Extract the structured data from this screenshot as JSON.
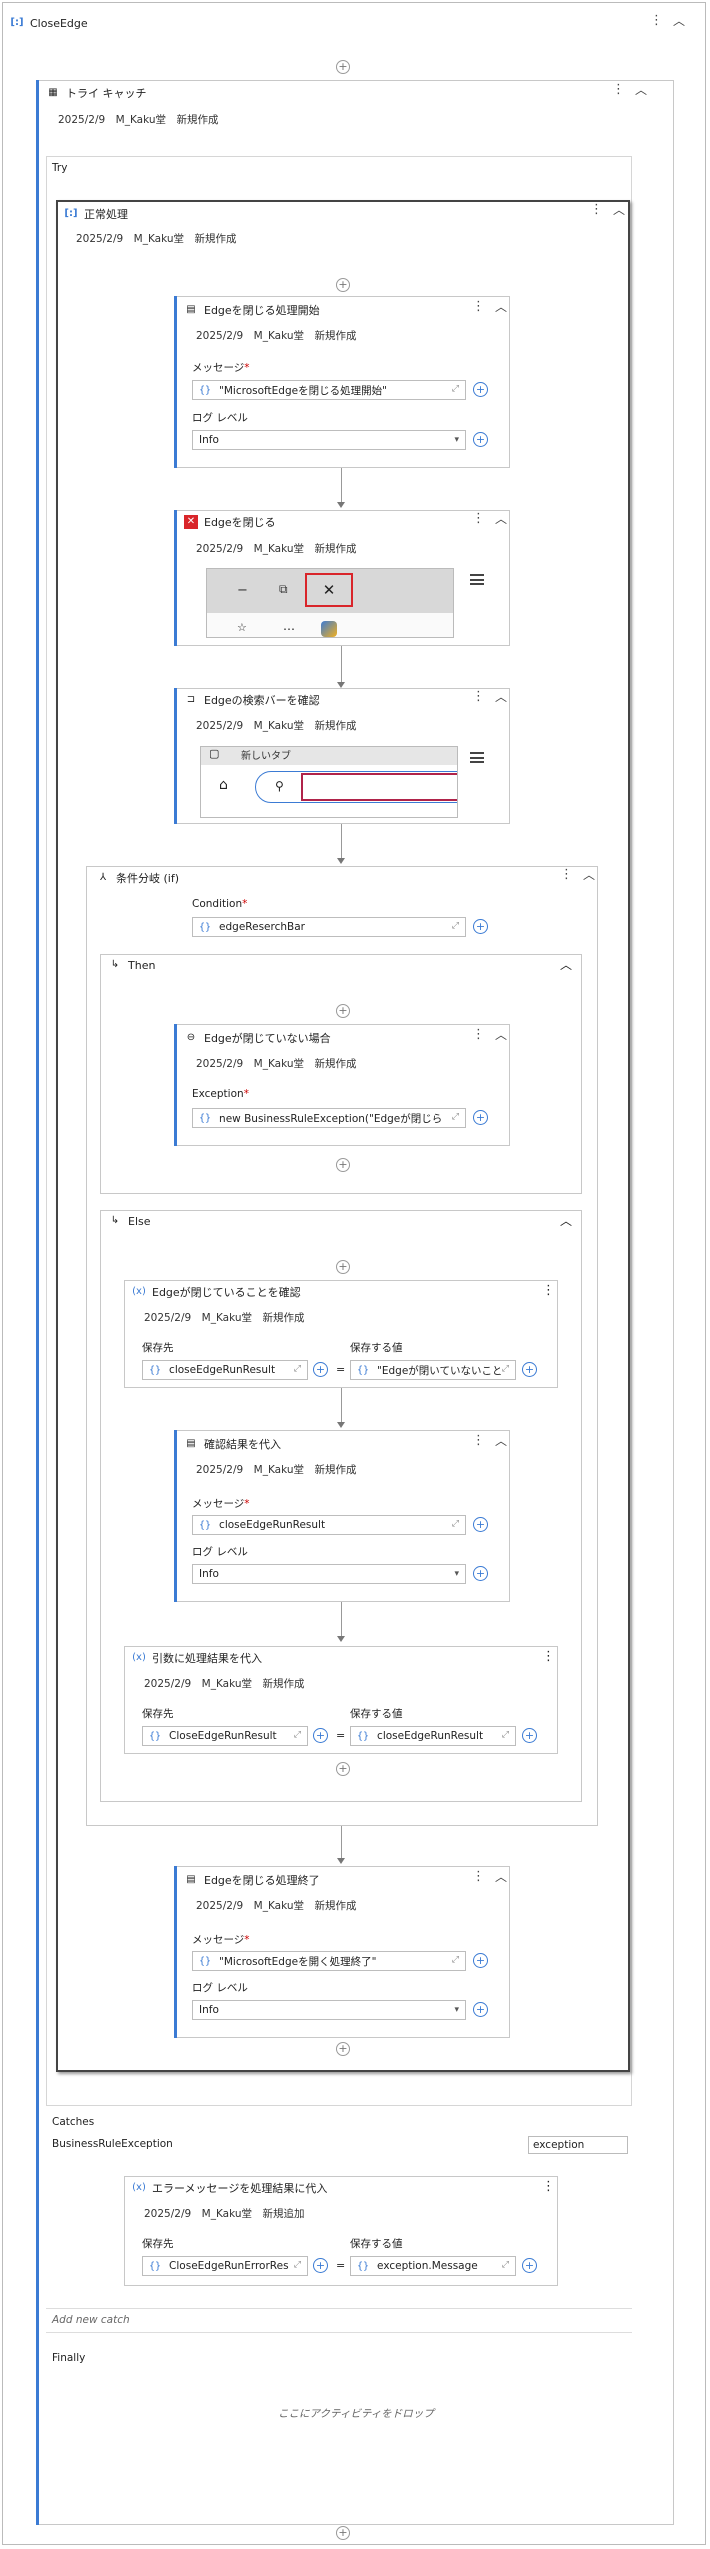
{
  "root": {
    "title": "CloseEdge"
  },
  "try_catch": {
    "title": "トライ キャッチ",
    "meta": "2025/2/9　M_Kaku堂　新規作成",
    "try_label": "Try",
    "catches_label": "Catches",
    "exception_type": "BusinessRuleException",
    "exception_var": "exception",
    "add_catch": "Add new catch",
    "finally_label": "Finally",
    "drop_hint": "ここにアクティビティをドロップ"
  },
  "seq": {
    "title": "正常処理",
    "meta": "2025/2/9　M_Kaku堂　新規作成"
  },
  "log1": {
    "title": "Edgeを閉じる処理開始",
    "meta": "2025/2/9　M_Kaku堂　新規作成",
    "msg_label": "メッセージ",
    "msg_value": "\"MicrosoftEdgeを閉じる処理開始\"",
    "level_label": "ログ レベル",
    "level_value": "Info"
  },
  "close": {
    "title": "Edgeを閉じる",
    "meta": "2025/2/9　M_Kaku堂　新規作成"
  },
  "check": {
    "title": "Edgeの検索バーを確認",
    "meta": "2025/2/9　M_Kaku堂　新規作成",
    "tab_text": "新しいタブ"
  },
  "if": {
    "title": "条件分岐 (if)",
    "cond_label": "Condition",
    "cond_value": "edgeReserchBar",
    "then_label": "Then",
    "else_label": "Else"
  },
  "throw": {
    "title": "Edgeが閉じていない場合",
    "meta": "2025/2/9　M_Kaku堂　新規作成",
    "exc_label": "Exception",
    "exc_value": "new BusinessRuleException(\"Edgeが閉じら"
  },
  "assign1": {
    "title": "Edgeが閉じていることを確認",
    "meta": "2025/2/9　M_Kaku堂　新規作成",
    "to_label": "保存先",
    "to_value": "closeEdgeRunResult",
    "val_label": "保存する値",
    "val_value": "\"Edgeが閉いていないこと"
  },
  "log2": {
    "title": "確認結果を代入",
    "meta": "2025/2/9　M_Kaku堂　新規作成",
    "msg_label": "メッセージ",
    "msg_value": "closeEdgeRunResult",
    "level_label": "ログ レベル",
    "level_value": "Info"
  },
  "assign2": {
    "title": "引数に処理結果を代入",
    "meta": "2025/2/9　M_Kaku堂　新規作成",
    "to_label": "保存先",
    "to_value": "CloseEdgeRunResult",
    "val_label": "保存する値",
    "val_value": "closeEdgeRunResult"
  },
  "log3": {
    "title": "Edgeを閉じる処理終了",
    "meta": "2025/2/9　M_Kaku堂　新規作成",
    "msg_label": "メッセージ",
    "msg_value": "\"MicrosoftEdgeを開く処理終了\"",
    "level_label": "ログ レベル",
    "level_value": "Info"
  },
  "assign3": {
    "title": "エラーメッセージを処理結果に代入",
    "meta": "2025/2/9　M_Kaku堂　新規追加",
    "to_label": "保存先",
    "to_value": "CloseEdgeRunErrorRes",
    "val_label": "保存する値",
    "val_value": "exception.Message"
  },
  "colors": {
    "accent": "#3b7bd4",
    "close_red": "#d9252a"
  }
}
